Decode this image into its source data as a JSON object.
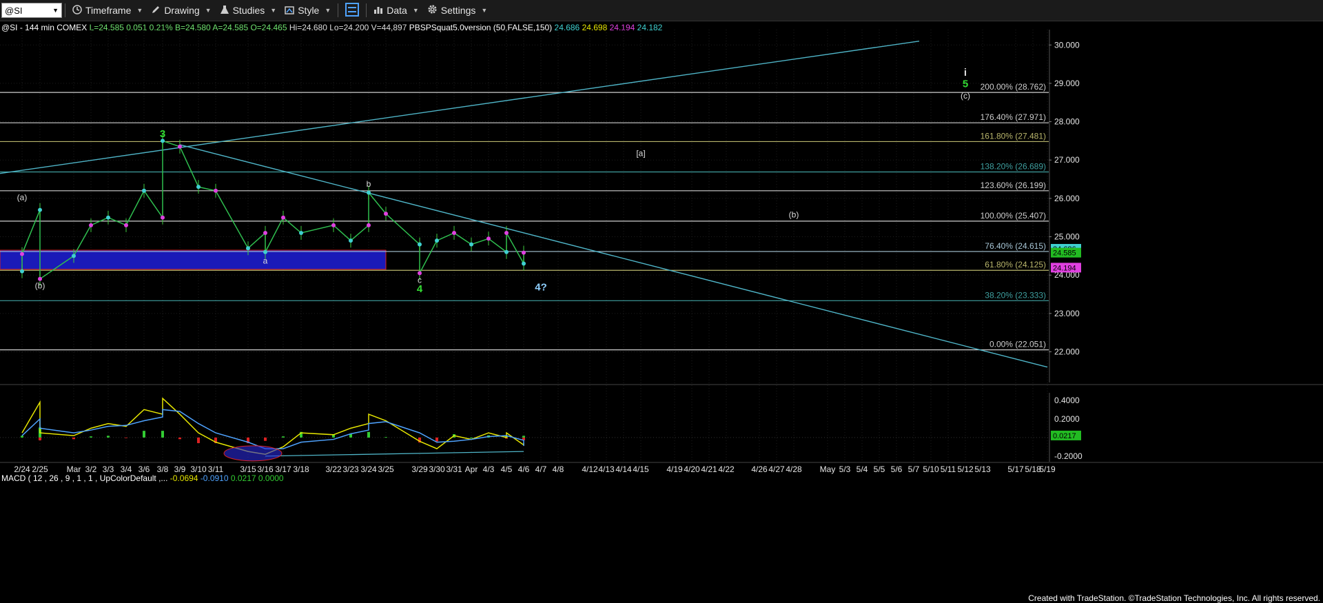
{
  "toolbar": {
    "symbol": "@SI",
    "items": [
      "Timeframe",
      "Drawing",
      "Studies",
      "Style",
      "Data",
      "Settings"
    ]
  },
  "header": {
    "title": "@SI - 144 min",
    "exchange": "COMEX",
    "quote_items": [
      {
        "text": "L=24.585",
        "color": "#6ee06e"
      },
      {
        "text": "0.051",
        "color": "#6ee06e"
      },
      {
        "text": "0.21%",
        "color": "#6ee06e"
      },
      {
        "text": "B=24.580",
        "color": "#6ee06e"
      },
      {
        "text": "A=24.585",
        "color": "#6ee06e"
      },
      {
        "text": "O=24.465",
        "color": "#6ee06e"
      },
      {
        "text": "Hi=24.680",
        "color": "#dddddd"
      },
      {
        "text": "Lo=24.200",
        "color": "#dddddd"
      },
      {
        "text": "V=44,897",
        "color": "#dddddd"
      }
    ],
    "indicator": "PBSPSquat5.0version (50,FALSE,150)",
    "indicator_values": [
      {
        "text": "24.686",
        "color": "#3fd0d0"
      },
      {
        "text": "24.698",
        "color": "#e6e600"
      },
      {
        "text": "24.194",
        "color": "#e040e0"
      },
      {
        "text": "24.182",
        "color": "#3fd0d0"
      }
    ]
  },
  "macd_header": {
    "label": "MACD ( 12 , 26 , 9 , 1 , 1 , UpColorDefault ,...",
    "values": [
      {
        "text": "-0.0694",
        "color": "#e6e600"
      },
      {
        "text": "-0.0910",
        "color": "#4fa3ff"
      },
      {
        "text": "0.0217",
        "color": "#33cc33"
      },
      {
        "text": "0.0000",
        "color": "#33cc33"
      }
    ]
  },
  "footer": "Created with TradeStation. ©TradeStation Technologies, Inc. All rights reserved.",
  "chart_data": [
    {
      "type": "candlestick-bar",
      "symbol": "@SI",
      "interval": "144 min",
      "x_tick_labels": [
        "2/24",
        "2/25",
        "Mar",
        "3/2",
        "3/3",
        "3/4",
        "3/6",
        "3/8",
        "3/9",
        "3/10",
        "3/11",
        "3/15",
        "3/16",
        "3/17",
        "3/18",
        "3/22",
        "3/23",
        "3/24",
        "3/25",
        "3/29",
        "3/30",
        "3/31",
        "Apr",
        "4/3",
        "4/5",
        "4/6",
        "4/7",
        "4/8",
        "4/12",
        "4/13",
        "4/14",
        "4/15",
        "4/19",
        "4/20",
        "4/21",
        "4/22",
        "4/26",
        "4/27",
        "4/28",
        "May",
        "5/3",
        "5/4",
        "5/5",
        "5/6",
        "5/7",
        "5/10",
        "5/11",
        "5/12",
        "5/13",
        "5/17",
        "5/18",
        "5/19"
      ],
      "ylim": [
        21.2,
        30.4
      ],
      "y_ticks": [
        "30.000",
        "29.000",
        "28.000",
        "27.000",
        "26.000",
        "25.000",
        "24.000",
        "23.000",
        "22.000"
      ],
      "price_points": [
        [
          "2/24",
          24.1
        ],
        [
          "2/24",
          24.55
        ],
        [
          "2/25",
          25.7
        ],
        [
          "2/25",
          23.9
        ],
        [
          "Mar",
          24.5
        ],
        [
          "3/2",
          25.3
        ],
        [
          "3/3",
          25.5
        ],
        [
          "3/4",
          25.3
        ],
        [
          "3/6",
          26.2
        ],
        [
          "3/8",
          25.5
        ],
        [
          "3/8",
          27.5
        ],
        [
          "3/9",
          27.35
        ],
        [
          "3/10",
          26.3
        ],
        [
          "3/11",
          26.2
        ],
        [
          "3/15",
          24.7
        ],
        [
          "3/16",
          25.1
        ],
        [
          "3/16",
          24.6
        ],
        [
          "3/17",
          25.5
        ],
        [
          "3/18",
          25.1
        ],
        [
          "3/22",
          25.3
        ],
        [
          "3/23",
          24.9
        ],
        [
          "3/24",
          25.3
        ],
        [
          "3/24",
          26.15
        ],
        [
          "3/25",
          25.6
        ],
        [
          "3/29",
          24.8
        ],
        [
          "3/29",
          24.05
        ],
        [
          "3/30",
          24.9
        ],
        [
          "3/31",
          25.1
        ],
        [
          "Apr",
          24.8
        ],
        [
          "4/3",
          24.95
        ],
        [
          "4/5",
          24.6
        ],
        [
          "4/5",
          25.1
        ],
        [
          "4/6",
          24.3
        ],
        [
          "4/6",
          24.585
        ]
      ],
      "last_price": 24.585,
      "price_tags": [
        {
          "value": 24.686,
          "text": "24.686",
          "color": "#3fd0d0"
        },
        {
          "value": 24.585,
          "text": "24.585",
          "color": "#22bb22"
        },
        {
          "value": 24.194,
          "text": "24.194",
          "color": "#e040e0"
        }
      ],
      "fib_levels": [
        {
          "label": "200.00% (28.762)",
          "value": 28.762,
          "color": "#cfcfcf"
        },
        {
          "label": "176.40% (27.971)",
          "value": 27.971,
          "color": "#cfcfcf"
        },
        {
          "label": "161.80% (27.481)",
          "value": 27.481,
          "color": "#b9b66c"
        },
        {
          "label": "138.20% (26.689)",
          "value": 26.689,
          "color": "#3fa0a0"
        },
        {
          "label": "123.60% (26.199)",
          "value": 26.199,
          "color": "#cfcfcf"
        },
        {
          "label": "100.00% (25.407)",
          "value": 25.407,
          "color": "#cfcfcf"
        },
        {
          "label": "76.40% (24.615)",
          "value": 24.615,
          "color": "#a9c8d8"
        },
        {
          "label": "61.80% (24.125)",
          "value": 24.125,
          "color": "#b9b66c"
        },
        {
          "label": "38.20% (23.333)",
          "value": 23.333,
          "color": "#3fa0a0"
        },
        {
          "label": "0.00% (22.051)",
          "value": 22.051,
          "color": "#cfcfcf"
        }
      ],
      "trendlines": [
        {
          "from": [
            "2/24",
            26.65
          ],
          "to": [
            "4/22",
            30.1
          ]
        },
        {
          "from": [
            "3/9",
            27.4
          ],
          "to": [
            "5/19",
            21.6
          ]
        }
      ],
      "support_box": {
        "x_from": "2/24",
        "x_to": "3/22",
        "y_from": 24.15,
        "y_to": 24.65,
        "color": "#1a1ab8"
      },
      "wave_labels": [
        {
          "text": "(a)",
          "x": "2/24",
          "y": 25.95,
          "color": "#dddddd"
        },
        {
          "text": "(b)",
          "x": "2/25",
          "y": 23.65,
          "color": "#dddddd"
        },
        {
          "text": "3",
          "x": "3/8",
          "y": 27.6,
          "color": "#33dd33"
        },
        {
          "text": "a",
          "x": "3/16",
          "y": 24.3,
          "color": "#dddddd"
        },
        {
          "text": "b",
          "x": "3/24",
          "y": 26.3,
          "color": "#dddddd"
        },
        {
          "text": "c",
          "x": "3/29",
          "y": 23.8,
          "color": "#dddddd"
        },
        {
          "text": "4",
          "x": "3/29",
          "y": 23.55,
          "color": "#33dd33"
        },
        {
          "text": "4?",
          "x": "4/7",
          "y": 23.6,
          "color": "#8fd0ff"
        },
        {
          "text": "[a]",
          "x": "4/15",
          "y": 27.1,
          "color": "#dddddd"
        },
        {
          "text": "(b)",
          "x": "4/28",
          "y": 25.5,
          "color": "#dddddd"
        },
        {
          "text": "i",
          "x": "5/12",
          "y": 29.2,
          "color": "#dddddd"
        },
        {
          "text": "5",
          "x": "5/12",
          "y": 28.9,
          "color": "#33dd33"
        },
        {
          "text": "(c)",
          "x": "5/12",
          "y": 28.6,
          "color": "#dddddd"
        }
      ]
    },
    {
      "type": "line",
      "name": "MACD",
      "ylim": [
        -0.26,
        0.48
      ],
      "y_ticks": [
        "0.4000",
        "0.2000",
        "-0.2000"
      ],
      "series": [
        {
          "name": "MACD",
          "color": "#e6e600",
          "values": [
            [
              "2/24",
              0.05
            ],
            [
              "2/25",
              0.38
            ],
            [
              "2/25",
              0.05
            ],
            [
              "Mar",
              0.02
            ],
            [
              "3/2",
              0.1
            ],
            [
              "3/3",
              0.15
            ],
            [
              "3/4",
              0.12
            ],
            [
              "3/6",
              0.3
            ],
            [
              "3/8",
              0.25
            ],
            [
              "3/8",
              0.42
            ],
            [
              "3/9",
              0.25
            ],
            [
              "3/10",
              0.05
            ],
            [
              "3/11",
              -0.05
            ],
            [
              "3/15",
              -0.15
            ],
            [
              "3/16",
              -0.18
            ],
            [
              "3/17",
              -0.1
            ],
            [
              "3/18",
              0.05
            ],
            [
              "3/22",
              0.03
            ],
            [
              "3/23",
              0.1
            ],
            [
              "3/24",
              0.15
            ],
            [
              "3/24",
              0.25
            ],
            [
              "3/25",
              0.18
            ],
            [
              "3/29",
              -0.04
            ],
            [
              "3/30",
              -0.12
            ],
            [
              "3/31",
              0.02
            ],
            [
              "Apr",
              -0.02
            ],
            [
              "4/3",
              0.05
            ],
            [
              "4/5",
              0.0
            ],
            [
              "4/5",
              0.05
            ],
            [
              "4/6",
              -0.08
            ],
            [
              "4/6",
              -0.06
            ]
          ]
        },
        {
          "name": "MACDAvg",
          "color": "#4fa3ff",
          "values": [
            [
              "2/24",
              0.02
            ],
            [
              "2/25",
              0.2
            ],
            [
              "2/25",
              0.1
            ],
            [
              "Mar",
              0.05
            ],
            [
              "3/2",
              0.08
            ],
            [
              "3/3",
              0.12
            ],
            [
              "3/4",
              0.13
            ],
            [
              "3/6",
              0.18
            ],
            [
              "3/8",
              0.22
            ],
            [
              "3/8",
              0.3
            ],
            [
              "3/9",
              0.28
            ],
            [
              "3/10",
              0.15
            ],
            [
              "3/11",
              0.05
            ],
            [
              "3/15",
              -0.05
            ],
            [
              "3/16",
              -0.12
            ],
            [
              "3/17",
              -0.12
            ],
            [
              "3/18",
              -0.05
            ],
            [
              "3/22",
              -0.02
            ],
            [
              "3/23",
              0.04
            ],
            [
              "3/24",
              0.08
            ],
            [
              "3/24",
              0.15
            ],
            [
              "3/25",
              0.17
            ],
            [
              "3/29",
              0.05
            ],
            [
              "3/30",
              -0.05
            ],
            [
              "3/31",
              -0.04
            ],
            [
              "Apr",
              -0.02
            ],
            [
              "4/3",
              0.01
            ],
            [
              "4/5",
              0.02
            ],
            [
              "4/5",
              0.02
            ],
            [
              "4/6",
              -0.03
            ],
            [
              "4/6",
              -0.09
            ]
          ]
        }
      ],
      "histogram_color_pos": "#33cc33",
      "histogram_color_neg": "#dd2222",
      "divergence_line": {
        "from": [
          "3/16",
          -0.2
        ],
        "to": [
          "4/6",
          -0.15
        ]
      },
      "circle_marker": {
        "x": "3/16",
        "y": -0.17,
        "color": "#2a2ad8"
      }
    }
  ]
}
